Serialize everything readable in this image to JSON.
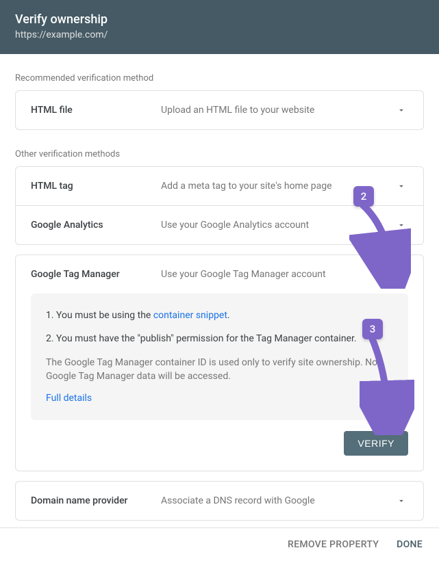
{
  "header": {
    "title": "Verify ownership",
    "url": "https://example.com/"
  },
  "section_labels": {
    "recommended": "Recommended verification method",
    "other": "Other verification methods"
  },
  "methods": {
    "html_file": {
      "name": "HTML file",
      "desc": "Upload an HTML file to your website"
    },
    "html_tag": {
      "name": "HTML tag",
      "desc": "Add a meta tag to your site's home page"
    },
    "ga": {
      "name": "Google Analytics",
      "desc": "Use your Google Analytics account"
    },
    "gtm": {
      "name": "Google Tag Manager",
      "desc": "Use your Google Tag Manager account"
    },
    "dns": {
      "name": "Domain name provider",
      "desc": "Associate a DNS record with Google"
    }
  },
  "gtm_details": {
    "line1_prefix": "1. You must be using the ",
    "line1_link": "container snippet",
    "line1_suffix": ".",
    "line2": "2. You must have the \"publish\" permission for the Tag Manager container.",
    "note": "The Google Tag Manager container ID is used only to verify site ownership. No Google Tag Manager data will be accessed.",
    "full_details": "Full details"
  },
  "buttons": {
    "verify": "VERIFY",
    "remove": "REMOVE PROPERTY",
    "done": "DONE"
  },
  "annotations": {
    "badge2": "2",
    "badge3": "3"
  }
}
